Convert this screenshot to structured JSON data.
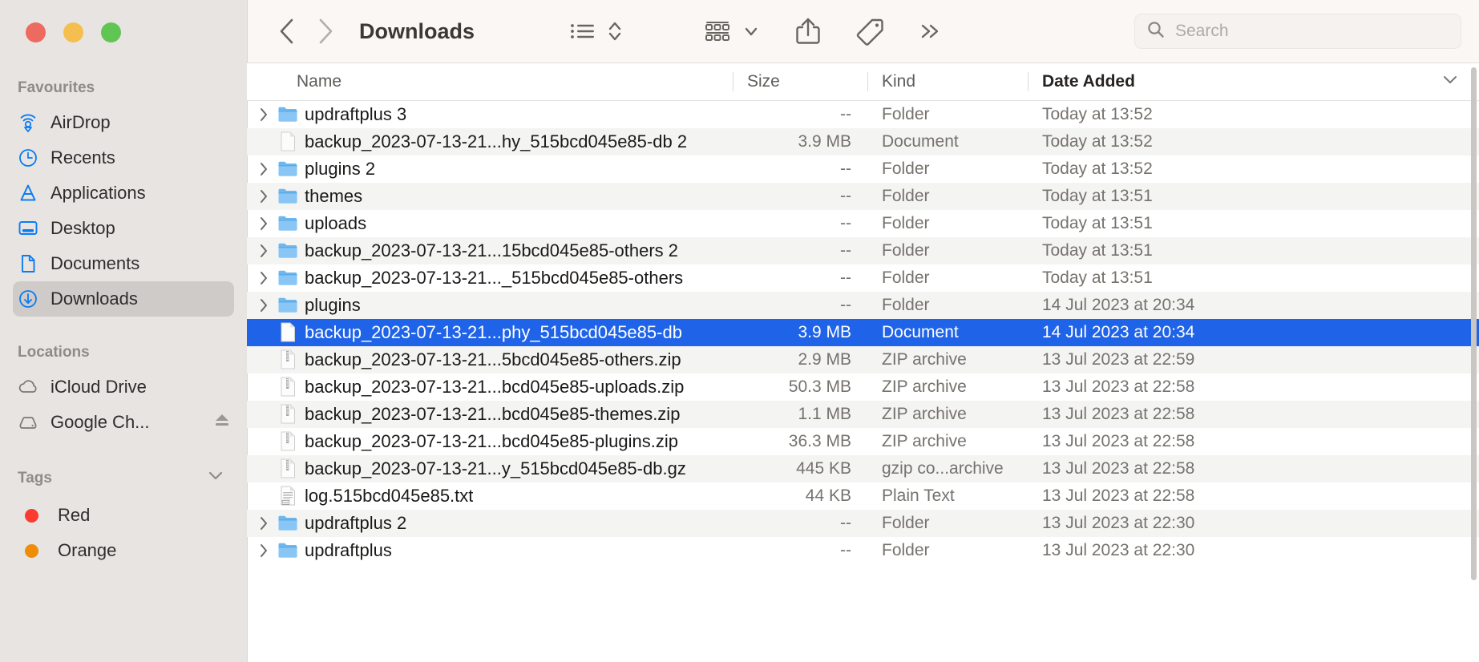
{
  "window": {
    "traffic_lights": [
      "close",
      "minimize",
      "zoom"
    ],
    "colors": {
      "close": "#ec6a5f",
      "minimize": "#f5bf4f",
      "zoom": "#61c554",
      "selection": "#1f63e8",
      "sidebar_bg": "#e8e4e1",
      "toolbar_bg": "#faf7f4"
    }
  },
  "toolbar": {
    "back_label": "Back",
    "forward_label": "Forward",
    "title": "Downloads",
    "view_label": "List View",
    "sort_label": "Sort",
    "group_label": "Group",
    "share_label": "Share",
    "tags_label": "Tags",
    "more_label": "More",
    "search_placeholder": "Search",
    "search_value": ""
  },
  "sidebar": {
    "sections": [
      {
        "title": "Favourites",
        "items": [
          {
            "label": "AirDrop",
            "icon": "airdrop-icon",
            "selected": false
          },
          {
            "label": "Recents",
            "icon": "clock-icon",
            "selected": false
          },
          {
            "label": "Applications",
            "icon": "applications-icon",
            "selected": false
          },
          {
            "label": "Desktop",
            "icon": "desktop-icon",
            "selected": false
          },
          {
            "label": "Documents",
            "icon": "document-icon",
            "selected": false
          },
          {
            "label": "Downloads",
            "icon": "downloads-icon",
            "selected": true
          }
        ]
      },
      {
        "title": "Locations",
        "items": [
          {
            "label": "iCloud Drive",
            "icon": "cloud-icon",
            "selected": false,
            "eject": false
          },
          {
            "label": "Google Ch...",
            "icon": "drive-icon",
            "selected": false,
            "eject": true
          }
        ]
      },
      {
        "title": "Tags",
        "collapsible": true,
        "items": [
          {
            "label": "Red",
            "icon": "tag-dot",
            "color": "#fc3b30",
            "selected": false
          },
          {
            "label": "Orange",
            "icon": "tag-dot",
            "color": "#ef8c08",
            "selected": false
          }
        ]
      }
    ]
  },
  "filelist": {
    "columns": [
      {
        "label": "Name",
        "sorted": false
      },
      {
        "label": "Size",
        "sorted": false
      },
      {
        "label": "Kind",
        "sorted": false
      },
      {
        "label": "Date Added",
        "sorted": true,
        "sort_direction": "descending"
      }
    ],
    "rows": [
      {
        "name": "updraftplus 3",
        "size": "--",
        "kind": "Folder",
        "date": "Today at 13:52",
        "icon": "folder-icon",
        "expandable": true,
        "selected": false
      },
      {
        "name": "backup_2023-07-13-21...hy_515bcd045e85-db 2",
        "size": "3.9 MB",
        "kind": "Document",
        "date": "Today at 13:52",
        "icon": "document-icon",
        "expandable": false,
        "selected": false
      },
      {
        "name": "plugins 2",
        "size": "--",
        "kind": "Folder",
        "date": "Today at 13:52",
        "icon": "folder-icon",
        "expandable": true,
        "selected": false
      },
      {
        "name": "themes",
        "size": "--",
        "kind": "Folder",
        "date": "Today at 13:51",
        "icon": "folder-icon",
        "expandable": true,
        "selected": false
      },
      {
        "name": "uploads",
        "size": "--",
        "kind": "Folder",
        "date": "Today at 13:51",
        "icon": "folder-icon",
        "expandable": true,
        "selected": false
      },
      {
        "name": "backup_2023-07-13-21...15bcd045e85-others 2",
        "size": "--",
        "kind": "Folder",
        "date": "Today at 13:51",
        "icon": "folder-icon",
        "expandable": true,
        "selected": false
      },
      {
        "name": "backup_2023-07-13-21..._515bcd045e85-others",
        "size": "--",
        "kind": "Folder",
        "date": "Today at 13:51",
        "icon": "folder-icon",
        "expandable": true,
        "selected": false
      },
      {
        "name": "plugins",
        "size": "--",
        "kind": "Folder",
        "date": "14 Jul 2023 at 20:34",
        "icon": "folder-icon",
        "expandable": true,
        "selected": false
      },
      {
        "name": "backup_2023-07-13-21...phy_515bcd045e85-db",
        "size": "3.9 MB",
        "kind": "Document",
        "date": "14 Jul 2023 at 20:34",
        "icon": "document-icon",
        "expandable": false,
        "selected": true
      },
      {
        "name": "backup_2023-07-13-21...5bcd045e85-others.zip",
        "size": "2.9 MB",
        "kind": "ZIP archive",
        "date": "13 Jul 2023 at 22:59",
        "icon": "zip-icon",
        "expandable": false,
        "selected": false
      },
      {
        "name": "backup_2023-07-13-21...bcd045e85-uploads.zip",
        "size": "50.3 MB",
        "kind": "ZIP archive",
        "date": "13 Jul 2023 at 22:58",
        "icon": "zip-icon",
        "expandable": false,
        "selected": false
      },
      {
        "name": "backup_2023-07-13-21...bcd045e85-themes.zip",
        "size": "1.1 MB",
        "kind": "ZIP archive",
        "date": "13 Jul 2023 at 22:58",
        "icon": "zip-icon",
        "expandable": false,
        "selected": false
      },
      {
        "name": "backup_2023-07-13-21...bcd045e85-plugins.zip",
        "size": "36.3 MB",
        "kind": "ZIP archive",
        "date": "13 Jul 2023 at 22:58",
        "icon": "zip-icon",
        "expandable": false,
        "selected": false
      },
      {
        "name": "backup_2023-07-13-21...y_515bcd045e85-db.gz",
        "size": "445 KB",
        "kind": "gzip co...archive",
        "date": "13 Jul 2023 at 22:58",
        "icon": "zip-icon",
        "expandable": false,
        "selected": false
      },
      {
        "name": "log.515bcd045e85.txt",
        "size": "44 KB",
        "kind": "Plain Text",
        "date": "13 Jul 2023 at 22:58",
        "icon": "txt-icon",
        "expandable": false,
        "selected": false
      },
      {
        "name": "updraftplus 2",
        "size": "--",
        "kind": "Folder",
        "date": "13 Jul 2023 at 22:30",
        "icon": "folder-icon",
        "expandable": true,
        "selected": false
      },
      {
        "name": "updraftplus",
        "size": "--",
        "kind": "Folder",
        "date": "13 Jul 2023 at 22:30",
        "icon": "folder-icon",
        "expandable": true,
        "selected": false
      }
    ]
  }
}
